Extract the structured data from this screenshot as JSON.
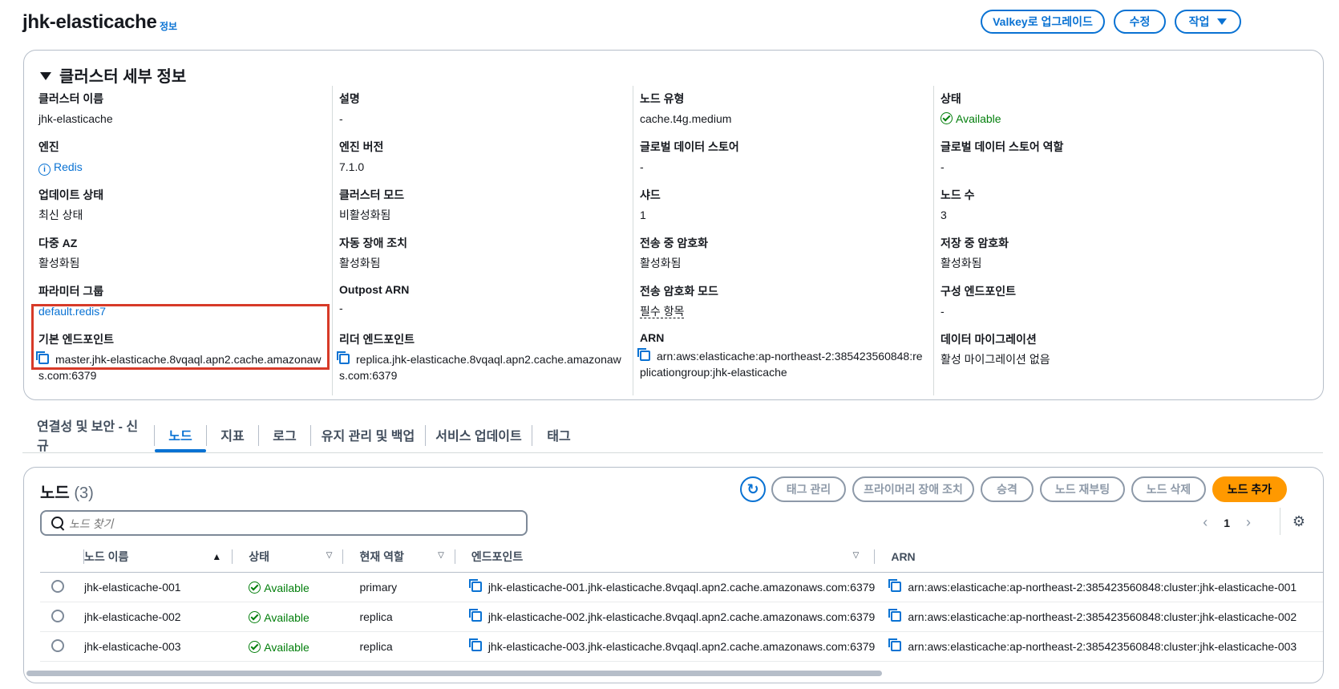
{
  "header": {
    "title": "jhk-elasticache",
    "info_link": "정보",
    "buttons": {
      "upgrade": "Valkey로 업그레이드",
      "edit": "수정",
      "actions": "작업"
    }
  },
  "details": {
    "title": "클러스터 세부 정보",
    "columns": [
      [
        {
          "label": "클러스터 이름",
          "value": "jhk-elasticache"
        },
        {
          "label": "엔진",
          "value": "Redis"
        },
        {
          "label": "업데이트 상태",
          "value": "최신 상태"
        },
        {
          "label": "다중 AZ",
          "value": "활성화됨"
        },
        {
          "label": "파라미터 그룹",
          "value": "default.redis7"
        },
        {
          "label": "기본 엔드포인트",
          "value": "master.jhk-elasticache.8vqaql.apn2.cache.amazonaws.com:6379"
        }
      ],
      [
        {
          "label": "설명",
          "value": "-"
        },
        {
          "label": "엔진 버전",
          "value": "7.1.0"
        },
        {
          "label": "클러스터 모드",
          "value": "비활성화됨"
        },
        {
          "label": "자동 장애 조치",
          "value": "활성화됨"
        },
        {
          "label": "Outpost ARN",
          "value": "-"
        },
        {
          "label": "리더 엔드포인트",
          "value": "replica.jhk-elasticache.8vqaql.apn2.cache.amazonaws.com:6379"
        }
      ],
      [
        {
          "label": "노드 유형",
          "value": "cache.t4g.medium"
        },
        {
          "label": "글로벌 데이터 스토어",
          "value": "-"
        },
        {
          "label": "샤드",
          "value": "1"
        },
        {
          "label": "전송 중 암호화",
          "value": "활성화됨"
        },
        {
          "label": "전송 암호화 모드",
          "value": "필수 항목"
        },
        {
          "label": "ARN",
          "value": "arn:aws:elasticache:ap-northeast-2:385423560848:replicationgroup:jhk-elasticache"
        }
      ],
      [
        {
          "label": "상태",
          "value": "Available"
        },
        {
          "label": "글로벌 데이터 스토어 역할",
          "value": "-"
        },
        {
          "label": "노드 수",
          "value": "3"
        },
        {
          "label": "저장 중 암호화",
          "value": "활성화됨"
        },
        {
          "label": "구성 엔드포인트",
          "value": "-"
        },
        {
          "label": "데이터 마이그레이션",
          "value": "활성 마이그레이션 없음"
        }
      ]
    ]
  },
  "tabs": [
    "연결성 및 보안 - 신규",
    "노드",
    "지표",
    "로그",
    "유지 관리 및 백업",
    "서비스 업데이트",
    "태그"
  ],
  "active_tab": "노드",
  "nodes": {
    "title": "노드",
    "count": "(3)",
    "buttons": [
      "태그 관리",
      "프라이머리 장애 조치",
      "승격",
      "노드 재부팅",
      "노드 삭제",
      "노드 추가"
    ],
    "search_placeholder": "노드 찾기",
    "page": "1",
    "columns": [
      "노드 이름",
      "상태",
      "현재 역할",
      "엔드포인트",
      "ARN"
    ],
    "rows": [
      {
        "name": "jhk-elasticache-001",
        "status": "Available",
        "role": "primary",
        "endpoint": "jhk-elasticache-001.jhk-elasticache.8vqaql.apn2.cache.amazonaws.com:6379",
        "arn": "arn:aws:elasticache:ap-northeast-2:385423560848:cluster:jhk-elasticache-001"
      },
      {
        "name": "jhk-elasticache-002",
        "status": "Available",
        "role": "replica",
        "endpoint": "jhk-elasticache-002.jhk-elasticache.8vqaql.apn2.cache.amazonaws.com:6379",
        "arn": "arn:aws:elasticache:ap-northeast-2:385423560848:cluster:jhk-elasticache-002"
      },
      {
        "name": "jhk-elasticache-003",
        "status": "Available",
        "role": "replica",
        "endpoint": "jhk-elasticache-003.jhk-elasticache.8vqaql.apn2.cache.amazonaws.com:6379",
        "arn": "arn:aws:elasticache:ap-northeast-2:385423560848:cluster:jhk-elasticache-003"
      }
    ]
  }
}
